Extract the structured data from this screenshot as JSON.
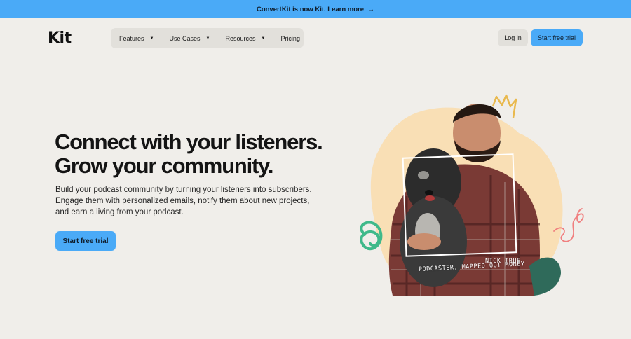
{
  "banner": {
    "text": "ConvertKit is now Kit. Learn more",
    "arrow": "→"
  },
  "header": {
    "logo": "Kit",
    "nav": [
      {
        "label": "Features",
        "has_menu": true
      },
      {
        "label": "Use Cases",
        "has_menu": true
      },
      {
        "label": "Resources",
        "has_menu": true
      },
      {
        "label": "Pricing",
        "has_menu": false
      }
    ],
    "login_label": "Log in",
    "trial_label": "Start free trial"
  },
  "hero": {
    "headline_line1": "Connect with your listeners.",
    "headline_line2": "Grow your community.",
    "subcopy": "Build your podcast community by turning your listeners into subscribers. Engage them with personalized emails, notify them about new projects, and earn a living from your podcast.",
    "cta_label": "Start free trial",
    "caption_name": "NICK TRUE",
    "caption_role": "PODCASTER, MAPPED OUT MONEY"
  },
  "colors": {
    "accent": "#4aaaf7",
    "background": "#f0eeea",
    "blob": "#f9dfb5",
    "squiggle_green": "#3fb98a",
    "squiggle_pink": "#f07f7f",
    "crown": "#e9b94e"
  }
}
